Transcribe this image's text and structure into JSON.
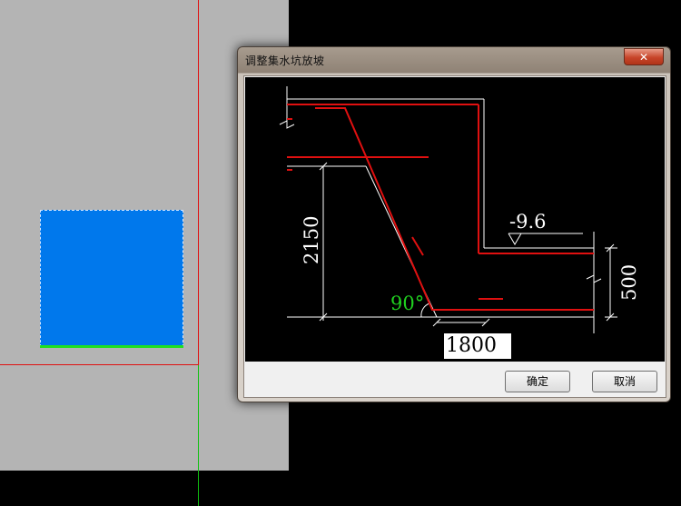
{
  "dialog": {
    "title": "调整集水坑放坡",
    "close_label": "✕",
    "ok_label": "确定",
    "cancel_label": "取消"
  },
  "drawing": {
    "elevation_label": "-9.6",
    "height_label": "2150",
    "depth_label": "500",
    "angle_label": "90°",
    "width_value": "1800"
  },
  "colors": {
    "rebar": "#e01010",
    "outline": "#ffffff",
    "angle_text": "#20d020",
    "pit_fill": "#0078ec"
  }
}
